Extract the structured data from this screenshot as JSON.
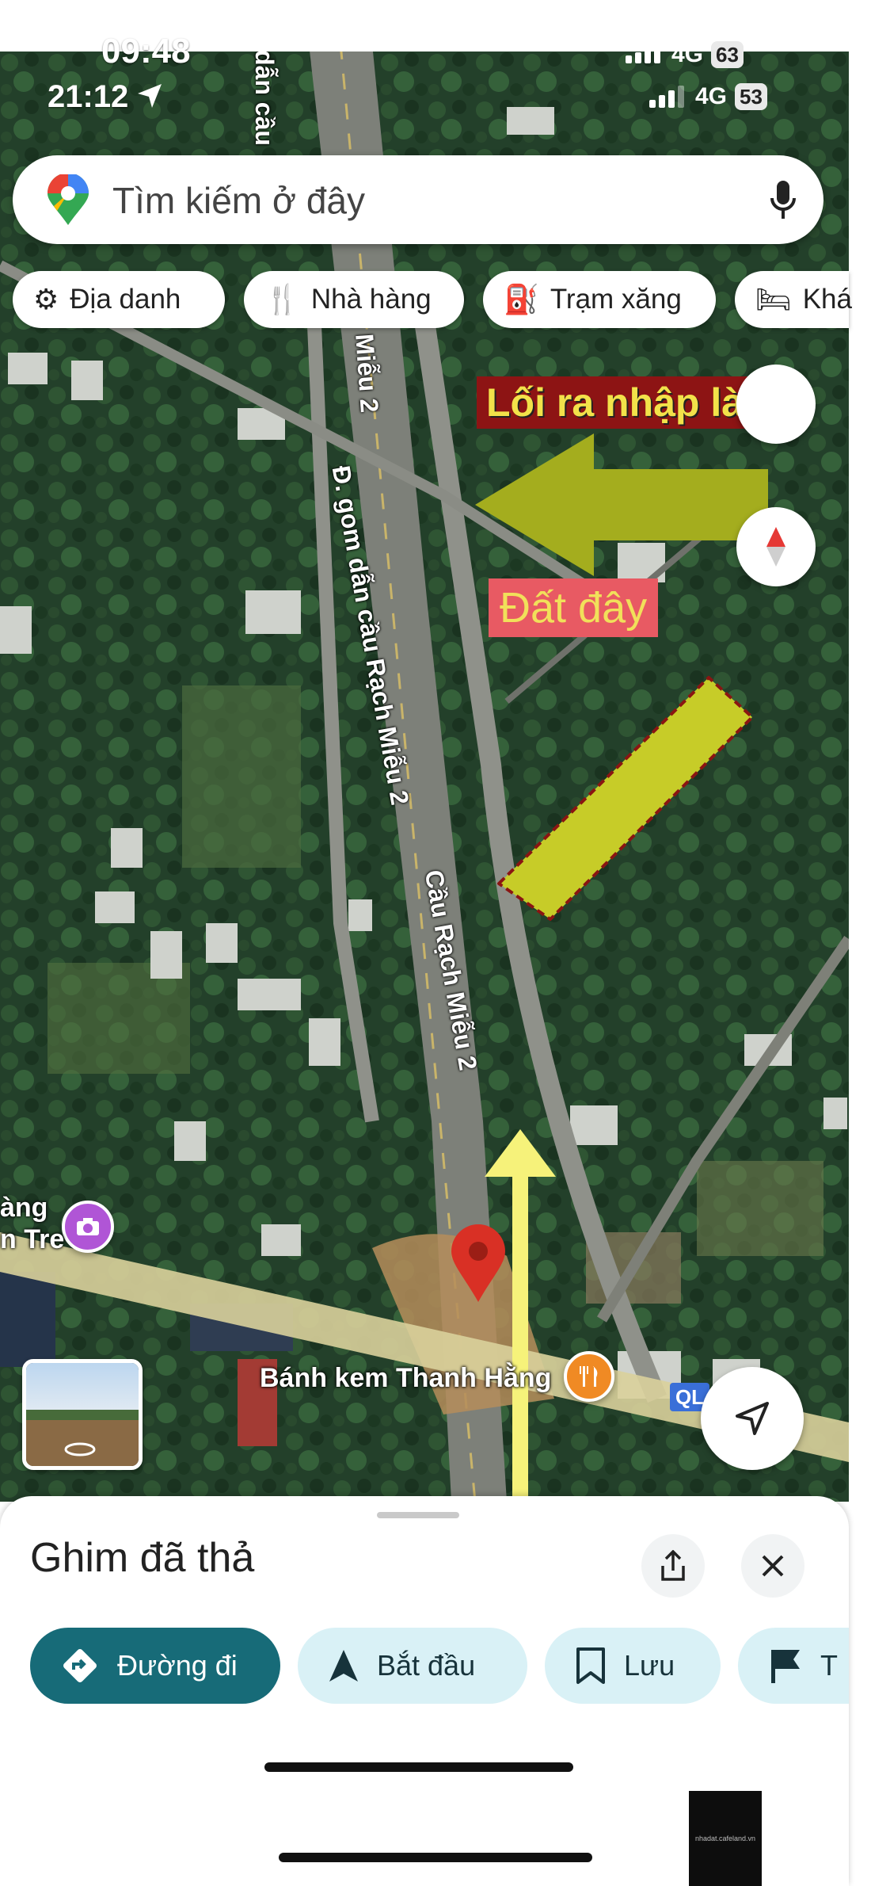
{
  "status": {
    "time_top": "09:48",
    "time": "21:12",
    "network": "4G",
    "network_top": "4G",
    "battery": "53",
    "battery_top": "63"
  },
  "search": {
    "placeholder": "Tìm kiếm ở đây"
  },
  "chips": [
    {
      "label": "Địa danh",
      "icon": "ferris-wheel-icon"
    },
    {
      "label": "Nhà hàng",
      "icon": "fork-knife-icon"
    },
    {
      "label": "Trạm xăng",
      "icon": "gas-pump-icon"
    },
    {
      "label": "Khá",
      "icon": "bed-icon"
    }
  ],
  "annotations": {
    "entrance": "Lối ra nhập làng",
    "land": "Đất đây"
  },
  "map_labels": {
    "road_gom": "Đ. gom dẫn cầu Rạch Miễu 2",
    "road_top": "dẫn cầu",
    "bridge": "Cầu Rạch Miễu 2",
    "poi_bakery": "Bánh kem Thanh Hằng",
    "poi_left_1": "àng",
    "poi_left_2": "n Tre",
    "shield": "QL",
    "road_fragment": "Miễu 2"
  },
  "colors": {
    "annotation_arrow": "#a4ad1e",
    "land_parcel": "#c7cc28",
    "up_arrow": "#f6f27a",
    "pin": "#d93025",
    "primary_button": "#176b78",
    "secondary_button": "#d9f1f6"
  },
  "sheet": {
    "title": "Ghim đã thả",
    "actions": [
      {
        "label": "Đường đi",
        "icon": "directions-icon"
      },
      {
        "label": "Bắt đầu",
        "icon": "navigation-arrow-icon"
      },
      {
        "label": "Lưu",
        "icon": "bookmark-icon"
      },
      {
        "label": "T",
        "icon": "flag-icon"
      }
    ]
  },
  "watermark": "nhadat.cafeland.vn"
}
